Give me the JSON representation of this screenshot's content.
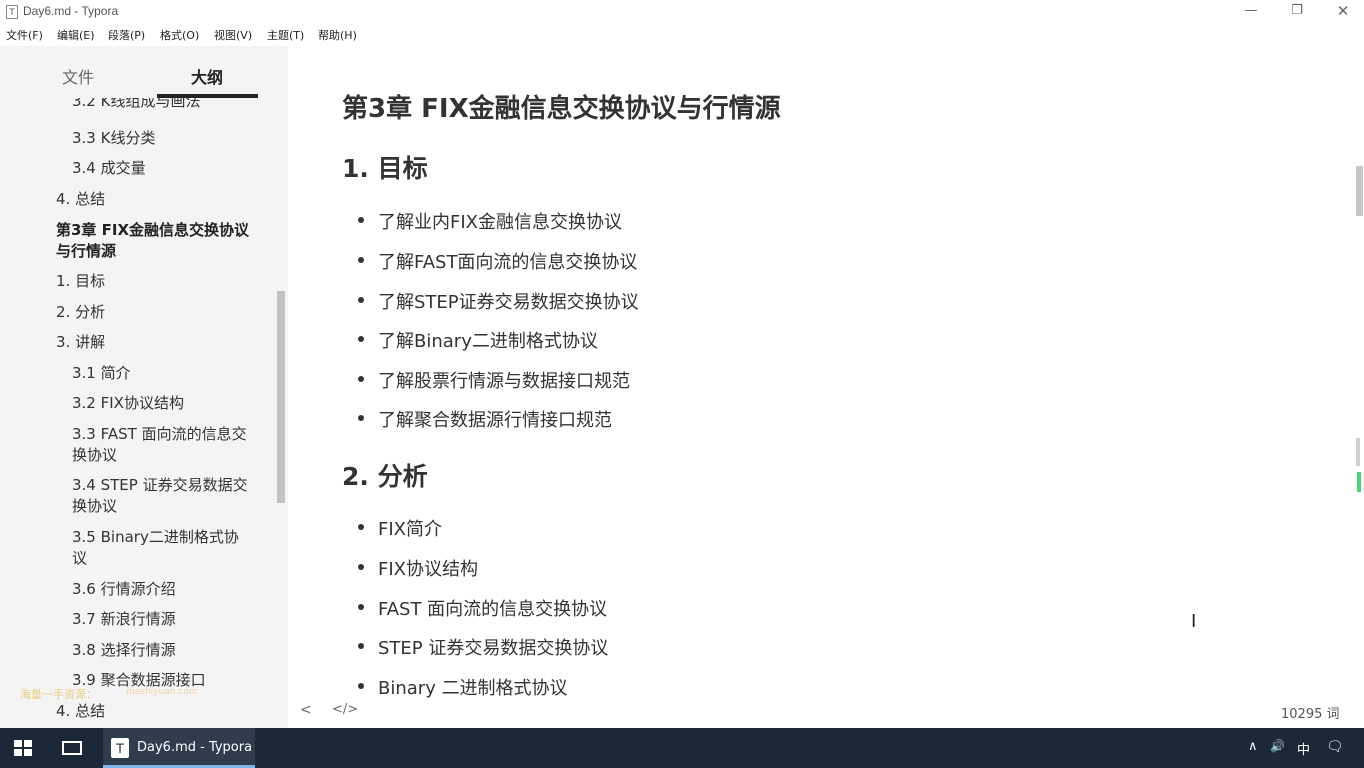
{
  "window": {
    "app_icon": "T",
    "title": "Day6.md - Typora",
    "minimize": "—",
    "maximize": "❐",
    "close": "✕"
  },
  "menu": [
    "文件(F)",
    "编辑(E)",
    "段落(P)",
    "格式(O)",
    "视图(V)",
    "主题(T)",
    "帮助(H)"
  ],
  "sidebar": {
    "tab_files": "文件",
    "tab_outline": "大纲",
    "outline": [
      "3.2 K线组成与画法",
      "3.3 K线分类",
      "3.4 成交量",
      "4. 总结",
      "第3章 FIX金融信息交换协议与行情源",
      "1. 目标",
      "2. 分析",
      "3. 讲解",
      "3.1 简介",
      "3.2 FIX协议结构",
      "3.3 FAST 面向流的信息交换协议",
      "3.4 STEP 证券交易数据交换协议",
      "3.5 Binary二进制格式协议",
      "3.6 行情源介绍",
      "3.7 新浪行情源",
      "3.8 选择行情源",
      "3.9 聚合数据源接口",
      "4. 总结"
    ],
    "watermark": "海量一手资源：",
    "watermark2": "mashiyuan.com"
  },
  "editor": {
    "h1": "第3章 FIX金融信息交换协议与行情源",
    "sections": [
      {
        "heading": "1. 目标",
        "items": [
          "了解业内FIX金融信息交换协议",
          "了解FAST面向流的信息交换协议",
          "了解STEP证券交易数据交换协议",
          "了解Binary二进制格式协议",
          "了解股票行情源与数据接口规范",
          "了解聚合数据源行情接口规范"
        ]
      },
      {
        "heading": "2. 分析",
        "items": [
          "FIX简介",
          "FIX协议结构",
          "FAST 面向流的信息交换协议",
          "STEP 证券交易数据交换协议",
          "Binary 二进制格式协议"
        ]
      }
    ],
    "cursor": "I"
  },
  "footer": {
    "back": "<",
    "source_toggle": "</>",
    "word_count": "10295 词"
  },
  "taskbar": {
    "app_icon": "T",
    "app_label": "Day6.md - Typora",
    "tray_up": "∧",
    "tray_volume": "🔊",
    "tray_ime": "中",
    "tray_notify": "🗨"
  },
  "colors": {
    "taskbar": "#1b2838",
    "sidebar": "#f4f4f4",
    "accent_scroll": "#4cd07a"
  }
}
